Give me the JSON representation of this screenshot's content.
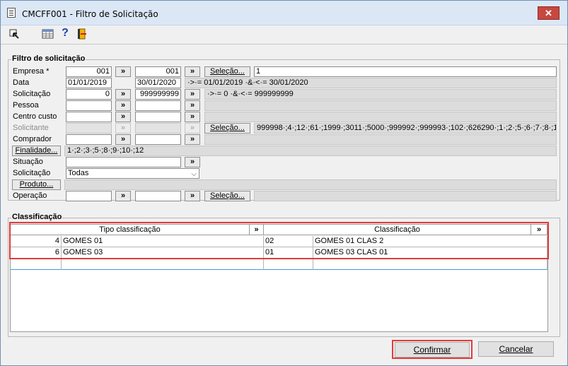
{
  "window": {
    "title": "CMCFF001 - Filtro de Solicitação",
    "close": "✕"
  },
  "toolbar": {
    "help": "?"
  },
  "filtro": {
    "legend": "Filtro de solicitação",
    "empresa": {
      "label": "Empresa *",
      "from": "001",
      "to": "001",
      "button": "Seleção...",
      "info": "1"
    },
    "data": {
      "label": "Data",
      "from": "01/01/2019",
      "to": "30/01/2020",
      "info": "·>·= 01/01/2019 ·&·<·= 30/01/2020"
    },
    "solicitacao": {
      "label": "Solicitação",
      "from": "0",
      "to": "999999999",
      "info": "·>·= 0 ·&·<·= 999999999"
    },
    "pessoa": {
      "label": "Pessoa"
    },
    "centro_custo": {
      "label": "Centro custo"
    },
    "solicitante": {
      "label": "Solicitante",
      "button": "Seleção...",
      "info": "999998·;4·;12·;61·;1999·;3011·;5000·;999992·;999993·;102·;626290·;1·;2·;5·;6·;7·;8·;1"
    },
    "comprador": {
      "label": "Comprador"
    },
    "finalidade": {
      "button": "Finalidade...",
      "info": "1·;2·;3·;5·;8·;9·;10·;12"
    },
    "situacao": {
      "label": "Situação"
    },
    "solicitacao_tipo": {
      "label": "Solicitação",
      "value": "Todas"
    },
    "produto": {
      "button": "Produto..."
    },
    "operacao": {
      "label": "Operação",
      "button": "Seleção..."
    },
    "arrow": "»"
  },
  "classificacao": {
    "legend": "Classificação",
    "headers": {
      "tipo": "Tipo classificação",
      "classif": "Classificação"
    },
    "rows": [
      {
        "num": "4",
        "tipo": "GOMES 01",
        "code": "02",
        "classif": "GOMES 01 CLAS 2"
      },
      {
        "num": "6",
        "tipo": "GOMES 03",
        "code": "01",
        "classif": "GOMES 03 CLAS 01"
      }
    ]
  },
  "buttons": {
    "confirm": "Confirmar",
    "cancel": "Cancelar"
  },
  "colors": {
    "highlight_red": "#e23b3b",
    "titlebar": "#dbe7f5",
    "close": "#c7483f"
  }
}
